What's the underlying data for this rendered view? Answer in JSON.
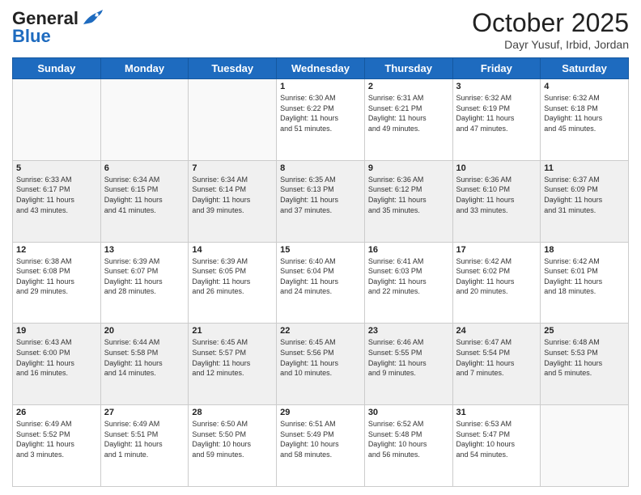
{
  "header": {
    "logo_line1": "General",
    "logo_line2": "Blue",
    "month": "October 2025",
    "location": "Dayr Yusuf, Irbid, Jordan"
  },
  "weekdays": [
    "Sunday",
    "Monday",
    "Tuesday",
    "Wednesday",
    "Thursday",
    "Friday",
    "Saturday"
  ],
  "weeks": [
    [
      {
        "day": "",
        "text": ""
      },
      {
        "day": "",
        "text": ""
      },
      {
        "day": "",
        "text": ""
      },
      {
        "day": "1",
        "text": "Sunrise: 6:30 AM\nSunset: 6:22 PM\nDaylight: 11 hours\nand 51 minutes."
      },
      {
        "day": "2",
        "text": "Sunrise: 6:31 AM\nSunset: 6:21 PM\nDaylight: 11 hours\nand 49 minutes."
      },
      {
        "day": "3",
        "text": "Sunrise: 6:32 AM\nSunset: 6:19 PM\nDaylight: 11 hours\nand 47 minutes."
      },
      {
        "day": "4",
        "text": "Sunrise: 6:32 AM\nSunset: 6:18 PM\nDaylight: 11 hours\nand 45 minutes."
      }
    ],
    [
      {
        "day": "5",
        "text": "Sunrise: 6:33 AM\nSunset: 6:17 PM\nDaylight: 11 hours\nand 43 minutes."
      },
      {
        "day": "6",
        "text": "Sunrise: 6:34 AM\nSunset: 6:15 PM\nDaylight: 11 hours\nand 41 minutes."
      },
      {
        "day": "7",
        "text": "Sunrise: 6:34 AM\nSunset: 6:14 PM\nDaylight: 11 hours\nand 39 minutes."
      },
      {
        "day": "8",
        "text": "Sunrise: 6:35 AM\nSunset: 6:13 PM\nDaylight: 11 hours\nand 37 minutes."
      },
      {
        "day": "9",
        "text": "Sunrise: 6:36 AM\nSunset: 6:12 PM\nDaylight: 11 hours\nand 35 minutes."
      },
      {
        "day": "10",
        "text": "Sunrise: 6:36 AM\nSunset: 6:10 PM\nDaylight: 11 hours\nand 33 minutes."
      },
      {
        "day": "11",
        "text": "Sunrise: 6:37 AM\nSunset: 6:09 PM\nDaylight: 11 hours\nand 31 minutes."
      }
    ],
    [
      {
        "day": "12",
        "text": "Sunrise: 6:38 AM\nSunset: 6:08 PM\nDaylight: 11 hours\nand 29 minutes."
      },
      {
        "day": "13",
        "text": "Sunrise: 6:39 AM\nSunset: 6:07 PM\nDaylight: 11 hours\nand 28 minutes."
      },
      {
        "day": "14",
        "text": "Sunrise: 6:39 AM\nSunset: 6:05 PM\nDaylight: 11 hours\nand 26 minutes."
      },
      {
        "day": "15",
        "text": "Sunrise: 6:40 AM\nSunset: 6:04 PM\nDaylight: 11 hours\nand 24 minutes."
      },
      {
        "day": "16",
        "text": "Sunrise: 6:41 AM\nSunset: 6:03 PM\nDaylight: 11 hours\nand 22 minutes."
      },
      {
        "day": "17",
        "text": "Sunrise: 6:42 AM\nSunset: 6:02 PM\nDaylight: 11 hours\nand 20 minutes."
      },
      {
        "day": "18",
        "text": "Sunrise: 6:42 AM\nSunset: 6:01 PM\nDaylight: 11 hours\nand 18 minutes."
      }
    ],
    [
      {
        "day": "19",
        "text": "Sunrise: 6:43 AM\nSunset: 6:00 PM\nDaylight: 11 hours\nand 16 minutes."
      },
      {
        "day": "20",
        "text": "Sunrise: 6:44 AM\nSunset: 5:58 PM\nDaylight: 11 hours\nand 14 minutes."
      },
      {
        "day": "21",
        "text": "Sunrise: 6:45 AM\nSunset: 5:57 PM\nDaylight: 11 hours\nand 12 minutes."
      },
      {
        "day": "22",
        "text": "Sunrise: 6:45 AM\nSunset: 5:56 PM\nDaylight: 11 hours\nand 10 minutes."
      },
      {
        "day": "23",
        "text": "Sunrise: 6:46 AM\nSunset: 5:55 PM\nDaylight: 11 hours\nand 9 minutes."
      },
      {
        "day": "24",
        "text": "Sunrise: 6:47 AM\nSunset: 5:54 PM\nDaylight: 11 hours\nand 7 minutes."
      },
      {
        "day": "25",
        "text": "Sunrise: 6:48 AM\nSunset: 5:53 PM\nDaylight: 11 hours\nand 5 minutes."
      }
    ],
    [
      {
        "day": "26",
        "text": "Sunrise: 6:49 AM\nSunset: 5:52 PM\nDaylight: 11 hours\nand 3 minutes."
      },
      {
        "day": "27",
        "text": "Sunrise: 6:49 AM\nSunset: 5:51 PM\nDaylight: 11 hours\nand 1 minute."
      },
      {
        "day": "28",
        "text": "Sunrise: 6:50 AM\nSunset: 5:50 PM\nDaylight: 10 hours\nand 59 minutes."
      },
      {
        "day": "29",
        "text": "Sunrise: 6:51 AM\nSunset: 5:49 PM\nDaylight: 10 hours\nand 58 minutes."
      },
      {
        "day": "30",
        "text": "Sunrise: 6:52 AM\nSunset: 5:48 PM\nDaylight: 10 hours\nand 56 minutes."
      },
      {
        "day": "31",
        "text": "Sunrise: 6:53 AM\nSunset: 5:47 PM\nDaylight: 10 hours\nand 54 minutes."
      },
      {
        "day": "",
        "text": ""
      }
    ]
  ]
}
